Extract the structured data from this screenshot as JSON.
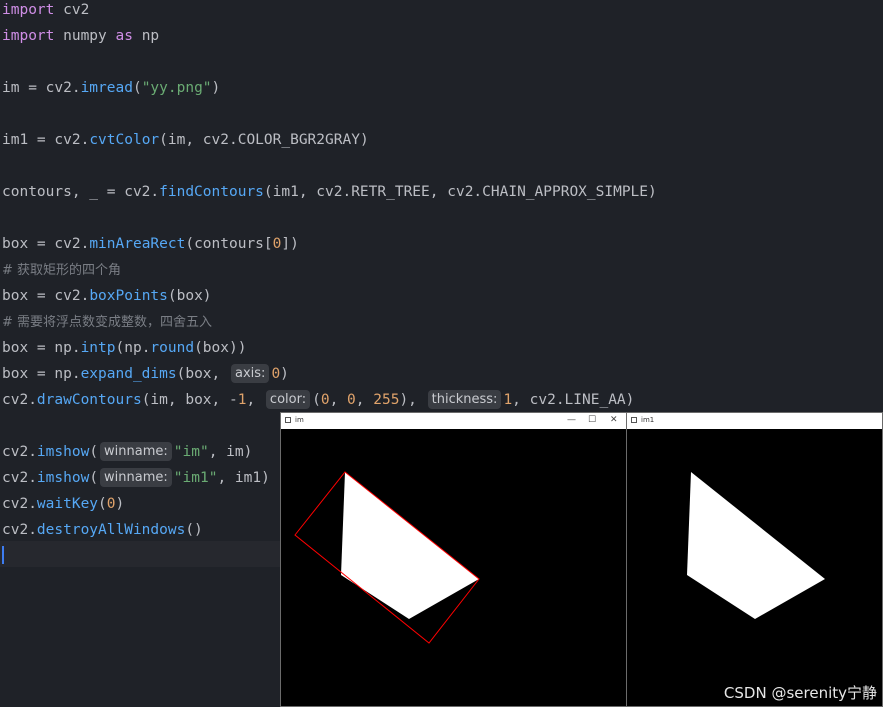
{
  "code": {
    "l1_kw": "import",
    "l1_mod": " cv2",
    "l2_kw": "import",
    "l2_mod": " numpy ",
    "l2_as": "as",
    "l2_alias": " np",
    "l3_a": "im = cv2.",
    "l3_fn": "imread",
    "l3_b": "(",
    "l3_str": "\"yy.png\"",
    "l3_c": ")",
    "l4_a": "im1 = cv2.",
    "l4_fn": "cvtColor",
    "l4_b": "(im, cv2.COLOR_BGR2GRAY)",
    "l5_a": "contours, _ = cv2.",
    "l5_fn": "findContours",
    "l5_b": "(im1, cv2.RETR_TREE, cv2.CHAIN_APPROX_SIMPLE)",
    "l6_a": "box = cv2.",
    "l6_fn": "minAreaRect",
    "l6_b": "(contours[",
    "l6_num": "0",
    "l6_c": "])",
    "l7_comment": "# 获取矩形的四个角",
    "l8_a": "box = cv2.",
    "l8_fn": "boxPoints",
    "l8_b": "(box)",
    "l9_comment": "# 需要将浮点数变成整数，四舍五入",
    "l10_a": "box = np.",
    "l10_fn1": "intp",
    "l10_b": "(np.",
    "l10_fn2": "round",
    "l10_c": "(box))",
    "l11_a": "box = np.",
    "l11_fn": "expand_dims",
    "l11_b": "(box, ",
    "l11_hint": "axis:",
    "l11_num": "0",
    "l11_c": ")",
    "l12_a": "cv2.",
    "l12_fn": "drawContours",
    "l12_b": "(im, box, -",
    "l12_num1": "1",
    "l12_c": ", ",
    "l12_hint1": "color:",
    "l12_d": "(",
    "l12_n2": "0",
    "l12_e": ", ",
    "l12_n3": "0",
    "l12_f": ", ",
    "l12_n4": "255",
    "l12_g": "), ",
    "l12_hint2": "thickness:",
    "l12_n5": "1",
    "l12_h": ", cv2.LINE_AA)",
    "l13_a": "cv2.",
    "l13_fn": "imshow",
    "l13_b": "(",
    "l13_hint": "winname:",
    "l13_str": "\"im\"",
    "l13_c": ", im)",
    "l14_a": "cv2.",
    "l14_fn": "imshow",
    "l14_b": "(",
    "l14_hint": "winname:",
    "l14_str": "\"im1\"",
    "l14_c": ", im1)",
    "l15_a": "cv2.",
    "l15_fn": "waitKey",
    "l15_b": "(",
    "l15_num": "0",
    "l15_c": ")",
    "l16_a": "cv2.",
    "l16_fn": "destroyAllWindows",
    "l16_b": "()"
  },
  "windows": {
    "im": {
      "title": "im",
      "minimize": "—",
      "maximize": "☐",
      "close": "✕"
    },
    "im1": {
      "title": "im1"
    }
  },
  "watermark": "CSDN @serenity宁静",
  "colors": {
    "background": "#1f2228",
    "keyword": "#cf8ee6",
    "function": "#56a8f5",
    "string": "#6aab73",
    "number": "#2aacb8",
    "comment": "#7a7e85",
    "contour": "#ff0000",
    "shape": "#ffffff"
  },
  "icons": {
    "window_icon": "window-app-icon"
  }
}
